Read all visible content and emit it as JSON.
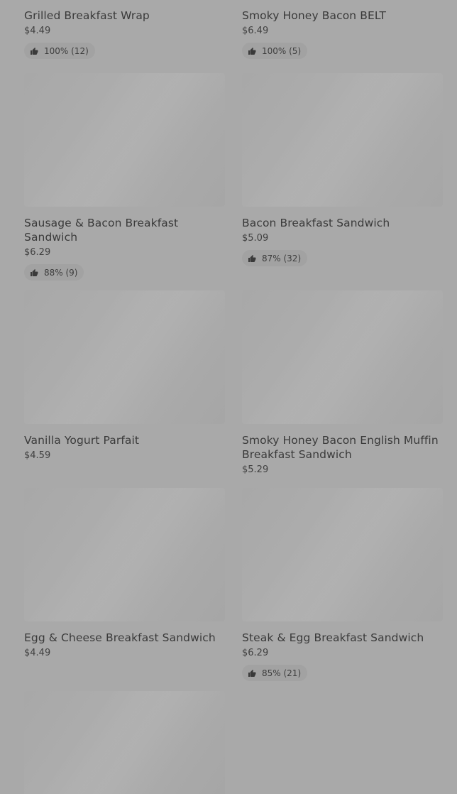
{
  "items": [
    {
      "name": "Grilled Breakfast Wrap",
      "price": "$4.49",
      "rating": "100% (12)"
    },
    {
      "name": "Smoky Honey Bacon BELT",
      "price": "$6.49",
      "rating": "100% (5)"
    },
    {
      "name": "Sausage & Bacon Breakfast Sandwich",
      "price": "$6.29",
      "rating": "88% (9)"
    },
    {
      "name": "Bacon Breakfast Sandwich",
      "price": "$5.09",
      "rating": "87% (32)"
    },
    {
      "name": "Vanilla Yogurt Parfait",
      "price": "$4.59",
      "rating": null
    },
    {
      "name": "Smoky Honey Bacon English Muffin Breakfast Sandwich",
      "price": "$5.29",
      "rating": null
    },
    {
      "name": "Egg & Cheese Breakfast Sandwich",
      "price": "$4.49",
      "rating": null
    },
    {
      "name": "Steak & Egg Breakfast Sandwich",
      "price": "$6.29",
      "rating": "85% (21)"
    }
  ],
  "icons": {
    "rating": "thumbs-up-icon"
  }
}
